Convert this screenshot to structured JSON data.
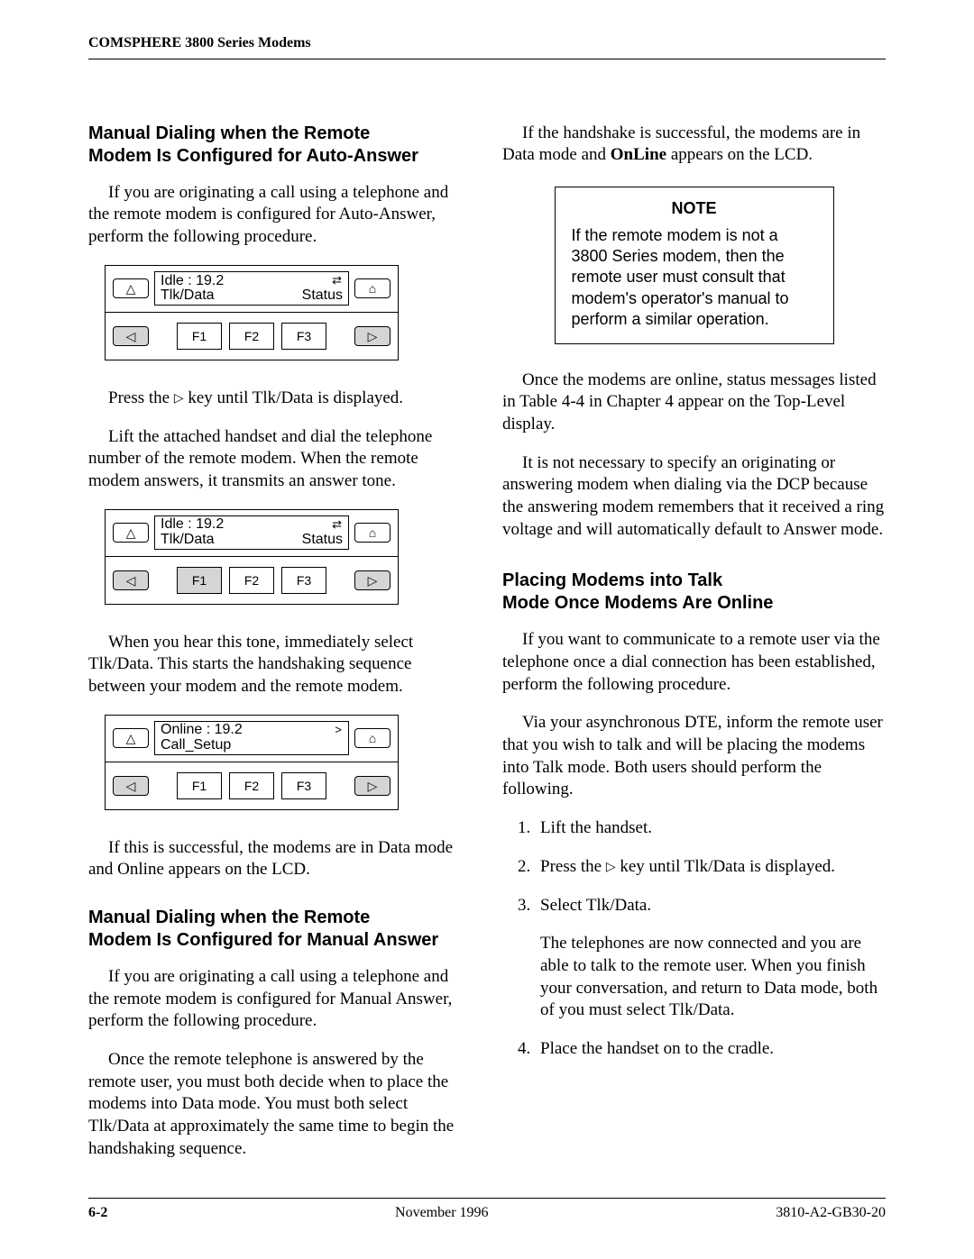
{
  "header": {
    "title": "COMSPHERE 3800 Series Modems"
  },
  "footer": {
    "page": "6-2",
    "date": "November 1996",
    "doc": "3810-A2-GB30-20"
  },
  "left": {
    "h_auto_1": "Manual Dialing when the Remote",
    "h_auto_2": "Modem Is Configured for Auto-Answer",
    "p1": "If you are originating a call using a telephone and the remote modem is configured for Auto-Answer, perform the following procedure.",
    "p2a": "Press the ",
    "p2b": " key until Tlk/Data is displayed.",
    "p3": "Lift the attached handset and dial the telephone number of the remote modem. When the remote modem answers, it transmits an answer tone.",
    "p4": "When you hear this tone, immediately select Tlk/Data. This starts the handshaking sequence between your modem and the remote modem.",
    "p5": "If this is successful, the modems are in Data mode and Online appears on the LCD.",
    "h_manual_1": "Manual Dialing when the Remote",
    "h_manual_2": "Modem Is Configured for Manual Answer",
    "p6": "If you are originating a call using a telephone and the remote modem is configured for Manual Answer, perform the following procedure.",
    "p7": "Once the remote telephone is answered by the remote user, you must both decide when to place the modems into Data mode. You must both select Tlk/Data at approximately the same time to begin the handshaking sequence."
  },
  "right": {
    "p1a": "If the handshake is successful, the modems are in Data mode and ",
    "p1b": "OnLine",
    "p1c": " appears on the LCD.",
    "note_title": "NOTE",
    "note_body": "If the remote modem is not a 3800 Series modem, then the remote user must consult that modem's operator's manual to perform a similar operation.",
    "p2": "Once the modems are online, status messages listed in Table 4-4 in Chapter 4 appear on the Top-Level display.",
    "p3": "It is not necessary to specify an originating or answering modem when dialing via the DCP because the answering modem remembers that it received a ring voltage and will automatically default to Answer mode.",
    "h_talk_1": "Placing Modems into Talk",
    "h_talk_2": "Mode Once Modems Are Online",
    "p4": "If you want to communicate to a remote user via the telephone once a dial connection has been established, perform the following procedure.",
    "p5": "Via your asynchronous DTE, inform the remote user that you wish to talk and will be placing the modems into Talk mode. Both users should perform the following.",
    "li1": "Lift the handset.",
    "li2a": "Press the ",
    "li2b": " key until Tlk/Data is displayed.",
    "li3": "Select Tlk/Data.",
    "li3_sub": "The telephones are now connected and you are able to talk to the remote user. When you finish your conversation, and return to Data mode, both of you must select Tlk/Data.",
    "li4": "Place the handset on to the cradle."
  },
  "panels": {
    "f1": "F1",
    "f2": "F2",
    "f3": "F3",
    "idle_line1": "Idle : 19.2",
    "idle_line2_left": "Tlk/Data",
    "idle_line2_right": "Status",
    "online_line1": "Online : 19.2",
    "online_line2_left": "Call_Setup",
    "online_arrow": ">"
  }
}
